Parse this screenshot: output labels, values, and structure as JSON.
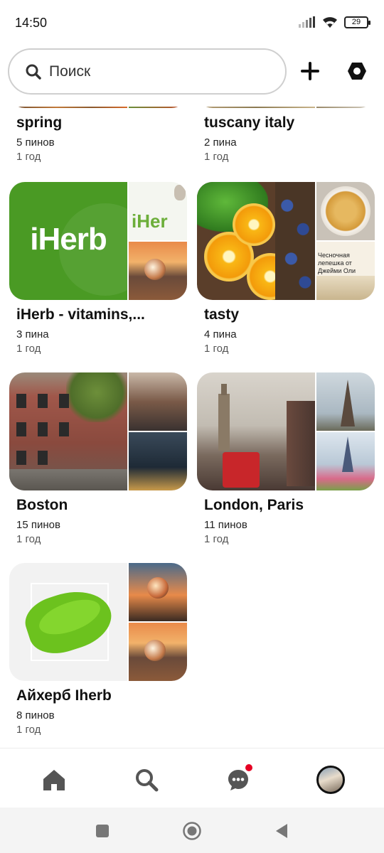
{
  "status_bar": {
    "time": "14:50",
    "battery": "29"
  },
  "header": {
    "search_placeholder": "Поиск"
  },
  "partial_boards": [
    {
      "title": "spring",
      "pins": "5 пинов",
      "age": "1 год"
    },
    {
      "title": "tuscany italy",
      "pins": "2 пина",
      "age": "1 год"
    }
  ],
  "boards": [
    {
      "title": "iHerb - vitamins,...",
      "pins": "3 пина",
      "age": "1 год",
      "logo_text": "iHerb",
      "side_logo_text": "iHer"
    },
    {
      "title": "tasty",
      "pins": "4 пина",
      "age": "1 год",
      "side_caption": "Чесночная лепешка от Джейми Оли"
    },
    {
      "title": "Boston",
      "pins": "15 пинов",
      "age": "1 год"
    },
    {
      "title": "London, Paris",
      "pins": "11 пинов",
      "age": "1 год"
    },
    {
      "title": "Айхерб Iherb",
      "pins": "8 пинов",
      "age": "1 год"
    }
  ],
  "bottom_nav": {
    "icons": [
      "home-icon",
      "search-icon",
      "messages-icon",
      "profile-avatar"
    ],
    "has_notification": true
  },
  "colors": {
    "accent": "#e60023",
    "iherb_green": "#4a9a24"
  }
}
